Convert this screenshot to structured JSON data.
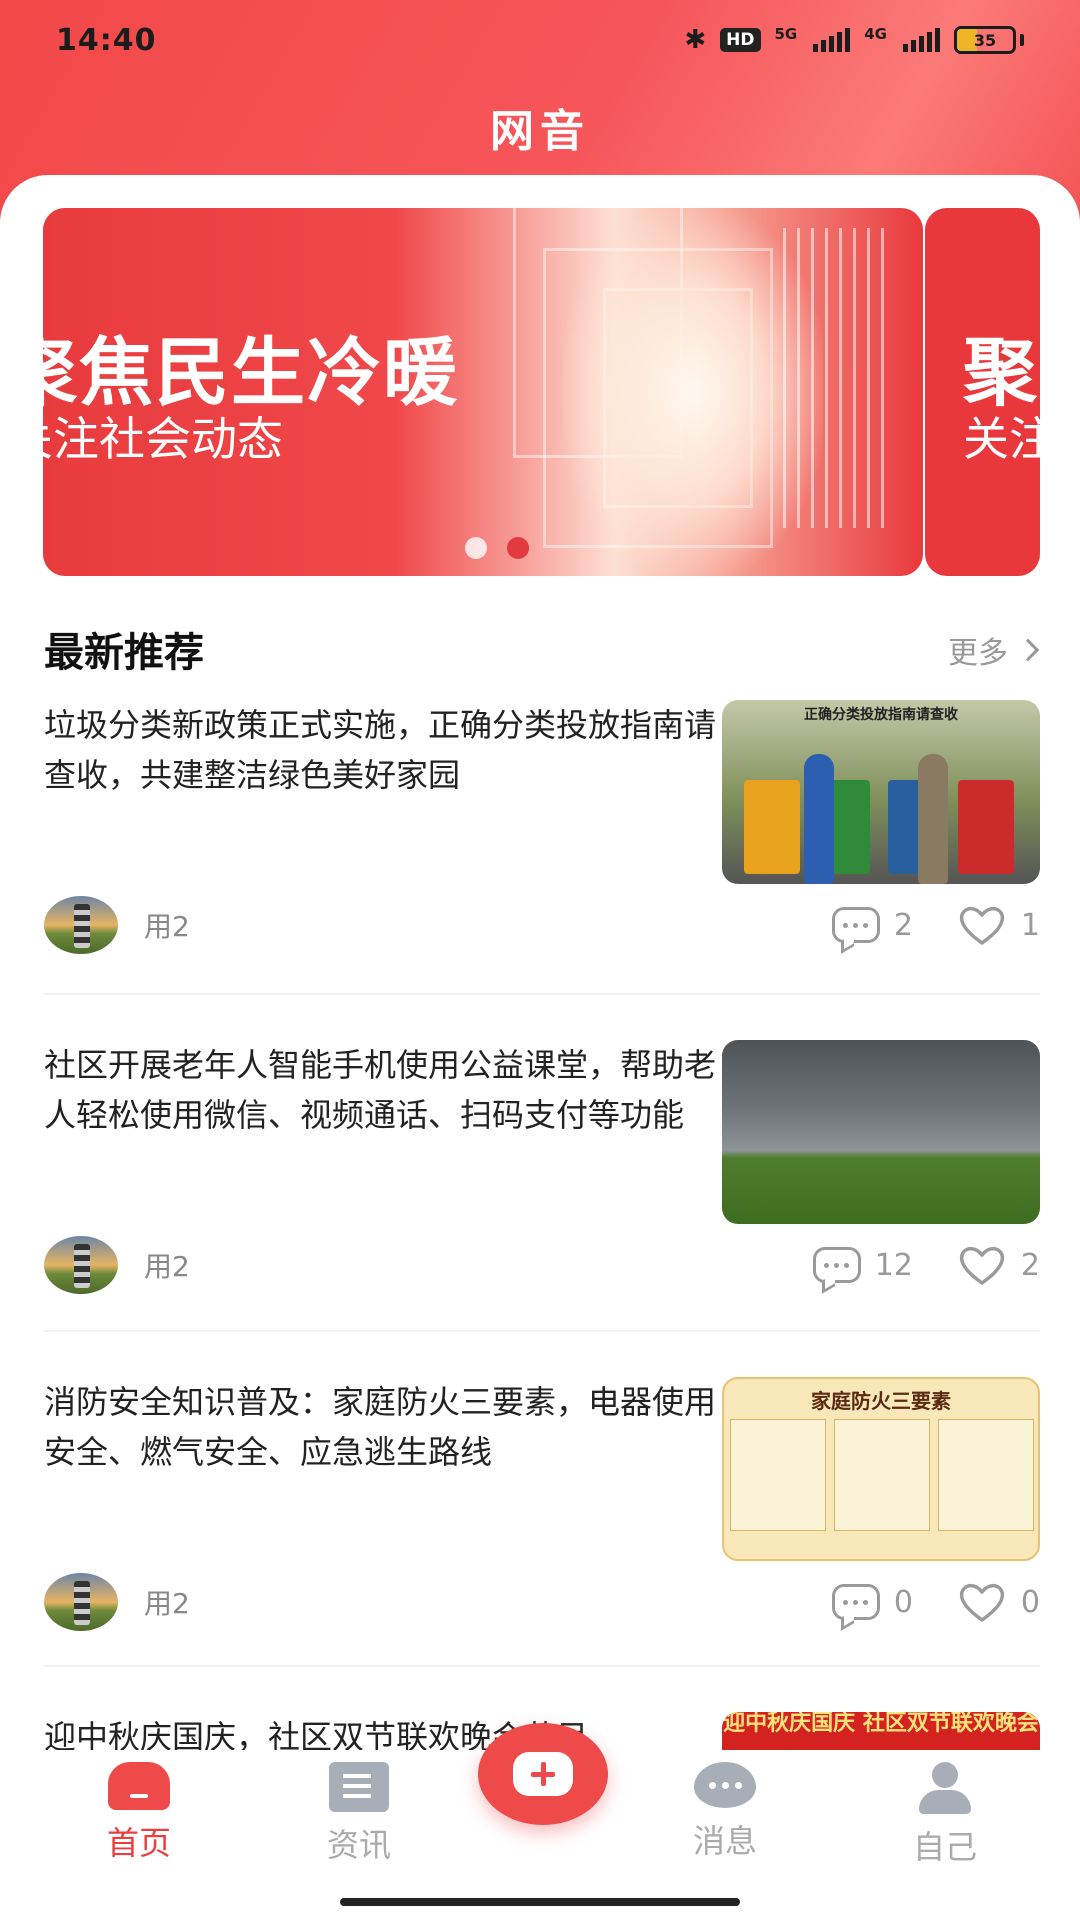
{
  "status_bar": {
    "time": "14:40",
    "hd": "HD",
    "net1": "5G",
    "net2": "4G",
    "battery": "35",
    "battery_level": 0.35,
    "icons": [
      "bluetooth-icon",
      "signal-5g-icon",
      "signal-4g-icon",
      "battery-icon"
    ]
  },
  "app": {
    "title": "网音"
  },
  "banner": {
    "title": "聚焦民生冷暖",
    "subtitle": "关注社会动态",
    "next_title": "聚",
    "next_subtitle": "关注",
    "active_index": 1,
    "slide_count": 2,
    "accent_color": "#e8383c"
  },
  "section": {
    "title": "最新推荐",
    "more": "更多"
  },
  "articles": [
    {
      "title": "垃圾分类新政策正式实施，正确分类投放指南请查收，共建整洁绿色美好家园",
      "author": "用2",
      "comments": "2",
      "likes": "1",
      "thumb_caption": "正确分类投放指南请查收"
    },
    {
      "title": "社区开展老年人智能手机使用公益课堂，帮助老人轻松使用微信、视频通话、扫码支付等功能",
      "author": "用2",
      "comments": "12",
      "likes": "2",
      "thumb_caption": ""
    },
    {
      "title": "消防安全知识普及：家庭防火三要素，电器使用安全、燃气安全、应急逃生路线",
      "author": "用2",
      "comments": "0",
      "likes": "0",
      "thumb_caption": "家庭防火三要素"
    },
    {
      "title": "迎中秋庆国庆，社区双节联欢晚会节目",
      "thumb_caption": "迎中秋庆国庆 社区双节联欢晚会"
    }
  ],
  "tabs": [
    {
      "label": "首页",
      "icon": "home-icon",
      "active": true
    },
    {
      "label": "资讯",
      "icon": "news-icon",
      "active": false
    },
    {
      "label": "消息",
      "icon": "message-icon",
      "active": false
    },
    {
      "label": "自己",
      "icon": "profile-icon",
      "active": false
    }
  ],
  "fab": {
    "icon": "add-post-icon"
  },
  "colors": {
    "primary": "#ef4a4a",
    "inactive": "#a8aeb8"
  }
}
